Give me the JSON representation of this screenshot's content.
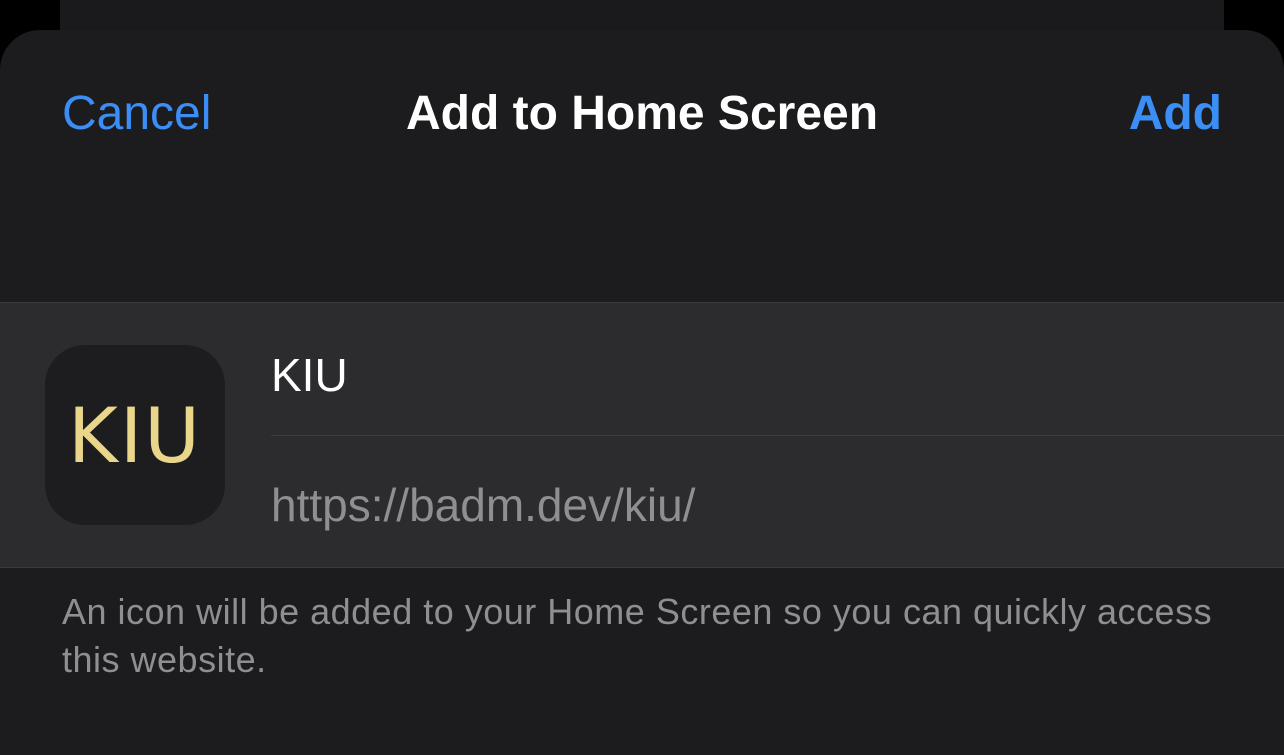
{
  "nav": {
    "cancel_label": "Cancel",
    "title": "Add to Home Screen",
    "add_label": "Add"
  },
  "app": {
    "icon_text": "KIU",
    "name": "KIU",
    "url": "https://badm.dev/kiu/"
  },
  "footer": {
    "note": "An icon will be added to your Home Screen so you can quickly access this website."
  },
  "colors": {
    "accent": "#3b8ef5",
    "sheet_background": "#1c1c1e",
    "group_background": "#2c2c2e",
    "icon_text": "#e9d68a",
    "secondary_text": "#8e8e93"
  }
}
